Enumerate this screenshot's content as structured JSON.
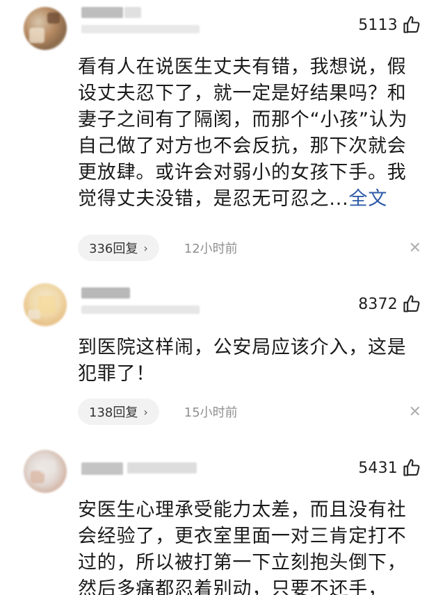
{
  "comments": [
    {
      "likes": "5113",
      "text": "看有人在说医生丈夫有错，我想说，假设丈夫忍下了，就一定是好结果吗？和妻子之间有了隔阂，而那个“小孩”认为自己做了对方也不会反抗，那下次就会更放肆。或许会对弱小的女孩下手。我觉得丈夫没错，是忍无可忍之...",
      "full_text_link": "全文",
      "reply_count": "336回复",
      "time": "12小时前"
    },
    {
      "likes": "8372",
      "text": "到医院这样闹，公安局应该介入，这是犯罪了！",
      "reply_count": "138回复",
      "time": "15小时前"
    },
    {
      "likes": "5431",
      "text": "安医生心理承受能力太差，而且没有社会经验了，更衣室里面一对三肯定打不过的，所以被打第一下立刻抱头倒下，然后多痛都忍着别动，只要不还手，"
    }
  ],
  "icons": {
    "like": "thumbs-up-icon",
    "close": "close-icon",
    "chevron": "chevron-right-icon"
  },
  "colors": {
    "link": "#2e5aa7",
    "meta": "#8f8f8f"
  }
}
